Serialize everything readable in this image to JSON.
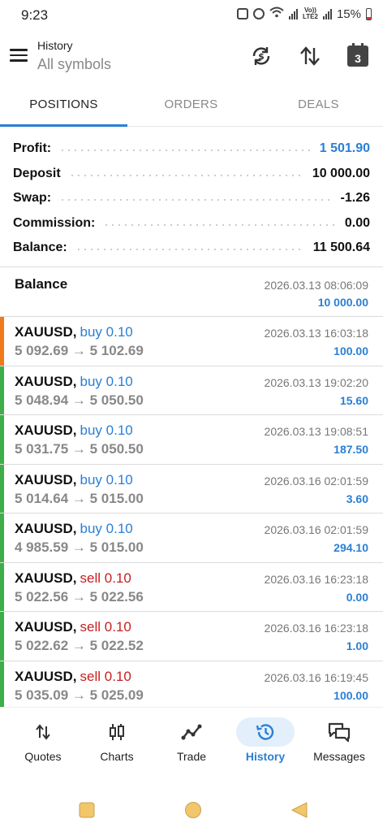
{
  "status_bar": {
    "time": "9:23",
    "network_tag_top": "Vo))",
    "network_tag_bottom": "LTE2",
    "battery": "15%"
  },
  "header": {
    "title": "History",
    "subtitle": "All symbols",
    "calendar_day": "3"
  },
  "tabs": [
    {
      "label": "POSITIONS",
      "active": true
    },
    {
      "label": "ORDERS",
      "active": false
    },
    {
      "label": "DEALS",
      "active": false
    }
  ],
  "summary": {
    "profit": {
      "label": "Profit:",
      "value": "1 501.90"
    },
    "deposit": {
      "label": "Deposit",
      "value": "10 000.00"
    },
    "swap": {
      "label": "Swap:",
      "value": "-1.26"
    },
    "commission": {
      "label": "Commission:",
      "value": "0.00"
    },
    "balance": {
      "label": "Balance:",
      "value": "11 500.64"
    }
  },
  "balance_entry": {
    "label": "Balance",
    "date": "2026.03.13 08:06:09",
    "amount": "10 000.00"
  },
  "trades": [
    {
      "symbol": "XAUUSD,",
      "side": "buy 0.10",
      "type": "buy",
      "prices": "5 092.69 → 5 102.69",
      "date": "2026.03.13 16:03:18",
      "profit": "100.00",
      "bar_color": "#f07a1a"
    },
    {
      "symbol": "XAUUSD,",
      "side": "buy 0.10",
      "type": "buy",
      "prices": "5 048.94 → 5 050.50",
      "date": "2026.03.13 19:02:20",
      "profit": "15.60",
      "bar_color": "#3fae49"
    },
    {
      "symbol": "XAUUSD,",
      "side": "buy 0.10",
      "type": "buy",
      "prices": "5 031.75 → 5 050.50",
      "date": "2026.03.13 19:08:51",
      "profit": "187.50",
      "bar_color": "#3fae49"
    },
    {
      "symbol": "XAUUSD,",
      "side": "buy 0.10",
      "type": "buy",
      "prices": "5 014.64 → 5 015.00",
      "date": "2026.03.16 02:01:59",
      "profit": "3.60",
      "bar_color": "#3fae49"
    },
    {
      "symbol": "XAUUSD,",
      "side": "buy 0.10",
      "type": "buy",
      "prices": "4 985.59 → 5 015.00",
      "date": "2026.03.16 02:01:59",
      "profit": "294.10",
      "bar_color": "#3fae49"
    },
    {
      "symbol": "XAUUSD,",
      "side": "sell 0.10",
      "type": "sell",
      "prices": "5 022.56 → 5 022.56",
      "date": "2026.03.16 16:23:18",
      "profit": "0.00",
      "bar_color": "#3fae49"
    },
    {
      "symbol": "XAUUSD,",
      "side": "sell 0.10",
      "type": "sell",
      "prices": "5 022.62 → 5 022.52",
      "date": "2026.03.16 16:23:18",
      "profit": "1.00",
      "bar_color": "#3fae49"
    },
    {
      "symbol": "XAUUSD,",
      "side": "sell 0.10",
      "type": "sell",
      "prices": "5 035.09 → 5 025.09",
      "date": "2026.03.16 16:19:45",
      "profit": "100.00",
      "bar_color": "#3fae49"
    }
  ],
  "bottom_nav": [
    {
      "label": "Quotes",
      "icon": "quotes-arrows-icon",
      "active": false
    },
    {
      "label": "Charts",
      "icon": "candlestick-icon",
      "active": false
    },
    {
      "label": "Trade",
      "icon": "trade-line-icon",
      "active": false
    },
    {
      "label": "History",
      "icon": "history-clock-icon",
      "active": true
    },
    {
      "label": "Messages",
      "icon": "chat-bubbles-icon",
      "active": false
    }
  ],
  "colors": {
    "accent": "#2a7fd4",
    "sell": "#c72020",
    "profit_bar": "#3fae49",
    "first_bar": "#f07a1a"
  }
}
